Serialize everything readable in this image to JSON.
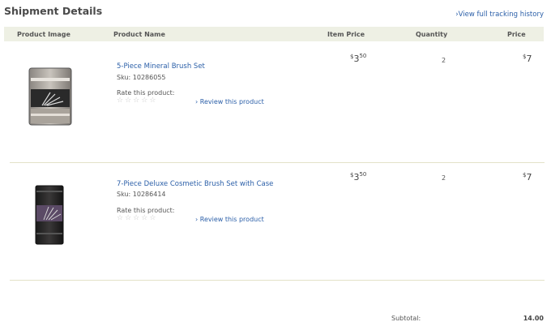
{
  "page": {
    "title": "Shipment Details",
    "tracking_link": "View full tracking history"
  },
  "table": {
    "headers": {
      "image": "Product Image",
      "name": "Product Name",
      "item_price": "Item Price",
      "quantity": "Quantity",
      "price": "Price"
    },
    "rows": [
      {
        "name": "5-Piece Mineral Brush Set",
        "sku": "Sku: 10286055",
        "rate_label": "Rate this product:",
        "review_label": "Review this product",
        "item_price_currency": "$",
        "item_price_whole": "3",
        "item_price_cents": "50",
        "quantity": "2",
        "price_currency": "$",
        "price_whole": "7",
        "image_icon": "brush-set-pouch",
        "rating_stars": 5
      },
      {
        "name": "7-Piece Deluxe Cosmetic Brush Set with Case",
        "sku": "Sku: 10286414",
        "rate_label": "Rate this product:",
        "review_label": "Review this product",
        "item_price_currency": "$",
        "item_price_whole": "3",
        "item_price_cents": "50",
        "quantity": "2",
        "price_currency": "$",
        "price_whole": "7",
        "image_icon": "brush-case",
        "rating_stars": 5
      }
    ]
  },
  "summary": {
    "subtotal_label": "Subtotal:",
    "subtotal_value": "14.00"
  },
  "colors": {
    "link": "#2b5fa8",
    "header_bg": "#eef0e4",
    "divider": "#e3e2c8"
  }
}
